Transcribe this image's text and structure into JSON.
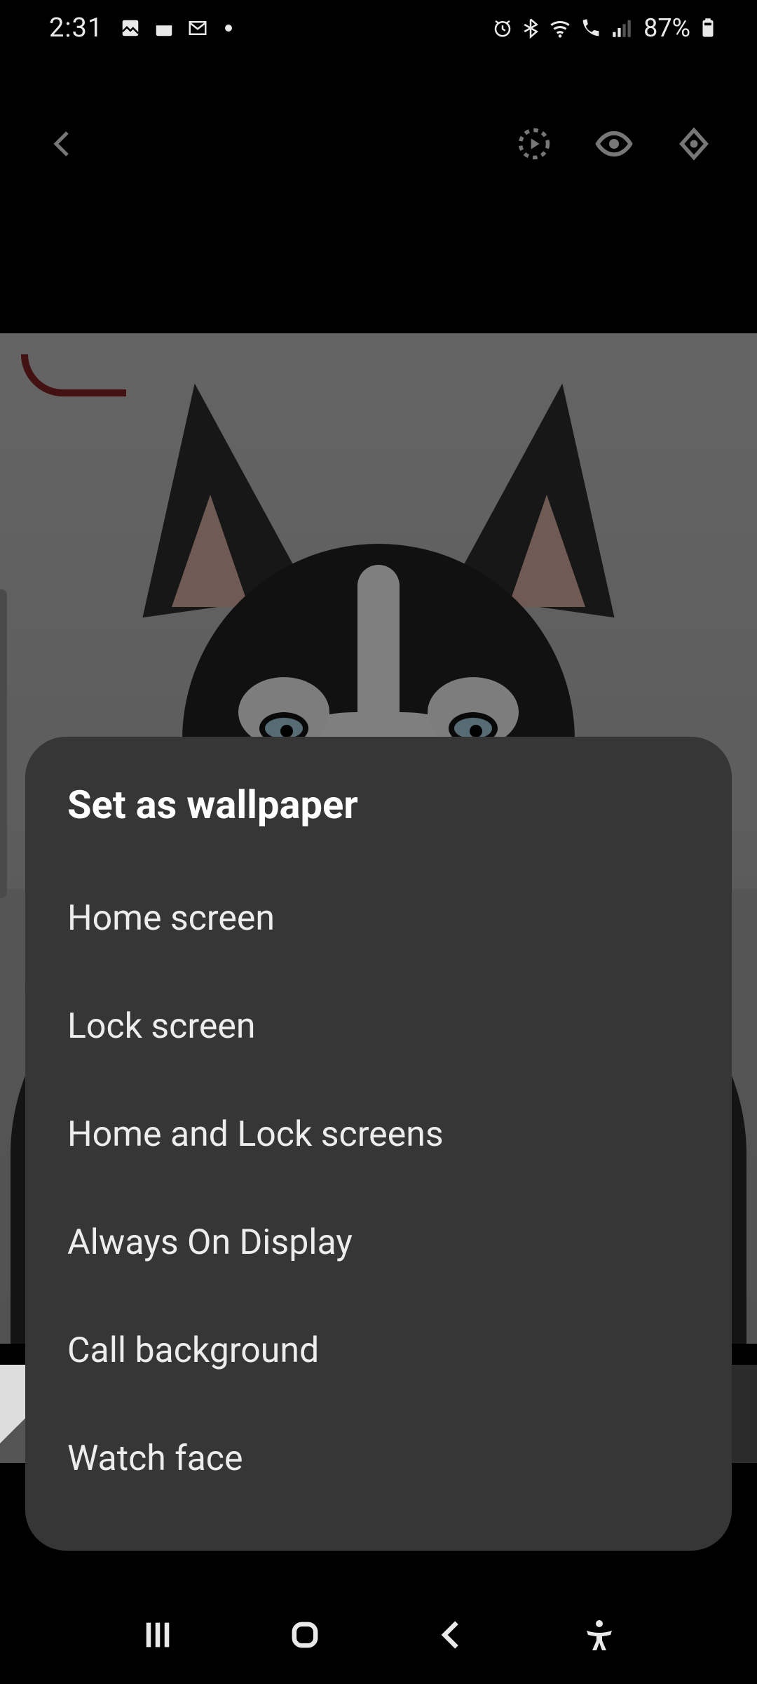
{
  "status": {
    "time": "2:31",
    "battery": "87%",
    "icons_left": [
      "gallery-icon",
      "today-icon",
      "gmail-icon",
      "more-dot-icon"
    ],
    "icons_right": [
      "alarm-icon",
      "bluetooth-icon",
      "wifi-icon",
      "volte-icon",
      "signal-icon",
      "battery-icon"
    ]
  },
  "toolbar": {
    "back": "Back",
    "actions": [
      "motion-photo-icon",
      "preview-eye-icon",
      "smartthings-icon"
    ]
  },
  "dialog": {
    "title": "Set as wallpaper",
    "items": [
      "Home screen",
      "Lock screen",
      "Home and Lock screens",
      "Always On Display",
      "Call background",
      "Watch face"
    ]
  },
  "nav": {
    "recents": "Recents",
    "home": "Home",
    "back": "Back",
    "accessibility": "Accessibility"
  }
}
